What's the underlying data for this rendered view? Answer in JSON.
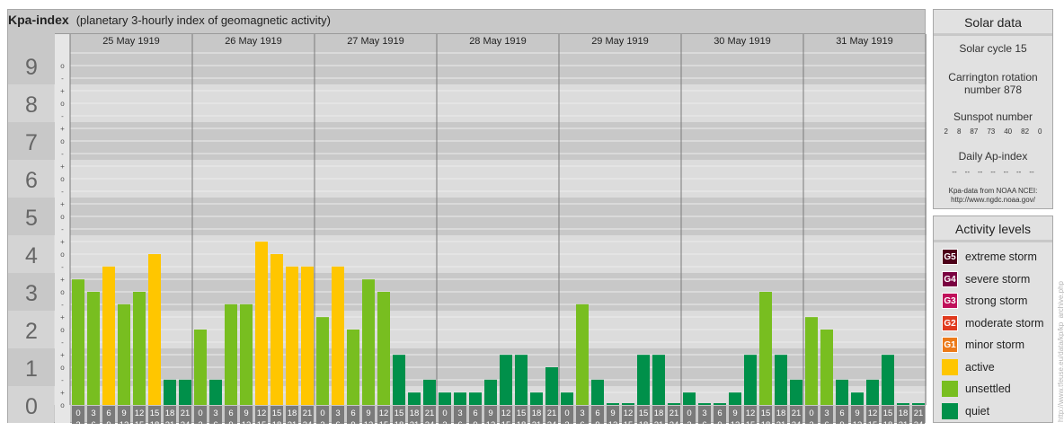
{
  "title": {
    "main": "Kpa-index",
    "subtitle": "(planetary 3-hourly index of geomagnetic activity)"
  },
  "chart_data": {
    "type": "bar",
    "ylim": [
      0,
      9
    ],
    "y_ticks": [
      "0",
      "1",
      "2",
      "3",
      "4",
      "5",
      "6",
      "7",
      "8",
      "9"
    ],
    "minor_tick_labels": [
      "+",
      "o",
      "-"
    ],
    "bar_ticks": [
      [
        "0",
        "3"
      ],
      [
        "3",
        "6"
      ],
      [
        "6",
        "9"
      ],
      [
        "9",
        "12"
      ],
      [
        "12",
        "15"
      ],
      [
        "15",
        "18"
      ],
      [
        "18",
        "21"
      ],
      [
        "21",
        "24"
      ]
    ],
    "days": [
      {
        "date": "25 May 1919",
        "values": [
          3.33,
          3.0,
          3.67,
          2.67,
          3.0,
          4.0,
          0.67,
          0.67
        ],
        "levels": [
          "unsettled",
          "unsettled",
          "active",
          "unsettled",
          "unsettled",
          "active",
          "quiet",
          "quiet"
        ]
      },
      {
        "date": "26 May 1919",
        "values": [
          2.0,
          0.67,
          2.67,
          2.67,
          4.33,
          4.0,
          3.67,
          3.67
        ],
        "levels": [
          "unsettled",
          "quiet",
          "unsettled",
          "unsettled",
          "active",
          "active",
          "active",
          "active"
        ]
      },
      {
        "date": "27 May 1919",
        "values": [
          2.33,
          3.67,
          2.0,
          3.33,
          3.0,
          1.33,
          0.33,
          0.67
        ],
        "levels": [
          "unsettled",
          "active",
          "unsettled",
          "unsettled",
          "unsettled",
          "quiet",
          "quiet",
          "quiet"
        ]
      },
      {
        "date": "28 May 1919",
        "values": [
          0.33,
          0.33,
          0.33,
          0.67,
          1.33,
          1.33,
          0.33,
          1.0
        ],
        "levels": [
          "quiet",
          "quiet",
          "quiet",
          "quiet",
          "quiet",
          "quiet",
          "quiet",
          "quiet"
        ]
      },
      {
        "date": "29 May 1919",
        "values": [
          0.33,
          2.67,
          0.67,
          0.0,
          0.0,
          1.33,
          1.33,
          0.0
        ],
        "levels": [
          "quiet",
          "unsettled",
          "quiet",
          "quiet",
          "quiet",
          "quiet",
          "quiet",
          "quiet"
        ]
      },
      {
        "date": "30 May 1919",
        "values": [
          0.33,
          0.0,
          0.0,
          0.33,
          1.33,
          3.0,
          1.33,
          0.67
        ],
        "levels": [
          "quiet",
          "quiet",
          "quiet",
          "quiet",
          "quiet",
          "unsettled",
          "quiet",
          "quiet"
        ]
      },
      {
        "date": "31 May 1919",
        "values": [
          2.33,
          2.0,
          0.67,
          0.33,
          0.67,
          1.33,
          0.0,
          0.0
        ],
        "levels": [
          "unsettled",
          "unsettled",
          "quiet",
          "quiet",
          "quiet",
          "quiet",
          "quiet",
          "quiet"
        ]
      }
    ]
  },
  "solar": {
    "heading": "Solar data",
    "cycle": "Solar cycle 15",
    "carrington_line1": "Carrington rotation",
    "carrington_line2": "number 878",
    "sunspot_heading": "Sunspot number",
    "sunspot_values": [
      "2",
      "8",
      "87",
      "73",
      "40",
      "82",
      "0"
    ],
    "ap_heading": "Daily Ap-index",
    "ap_values": [
      "--",
      "--",
      "--",
      "--",
      "--",
      "--",
      "--"
    ],
    "credit_line1": "Kpa-data from NOAA NCEI:",
    "credit_line2": "http://www.ngdc.noaa.gov/"
  },
  "legend": {
    "heading": "Activity levels",
    "items": [
      {
        "badge": "G5",
        "label": "extreme storm",
        "color": "#4d0019"
      },
      {
        "badge": "G4",
        "label": "severe storm",
        "color": "#7a0040"
      },
      {
        "badge": "G3",
        "label": "strong storm",
        "color": "#c0105a"
      },
      {
        "badge": "G2",
        "label": "moderate storm",
        "color": "#e03a1e"
      },
      {
        "badge": "G1",
        "label": "minor storm",
        "color": "#ec7a1a"
      },
      {
        "badge": "",
        "label": "active",
        "color": "#ffc600"
      },
      {
        "badge": "",
        "label": "unsettled",
        "color": "#78be20"
      },
      {
        "badge": "",
        "label": "quiet",
        "color": "#00904a"
      }
    ]
  },
  "colors": {
    "active": "#ffc600",
    "unsettled": "#78be20",
    "quiet": "#00904a",
    "band_dark": "#c8c8c8",
    "band_light": "#dcdcdc",
    "axis_gray": "#7a7a7a"
  },
  "watermark": "http://www.tfeuse.eu/data/kp/kp_archive.php"
}
